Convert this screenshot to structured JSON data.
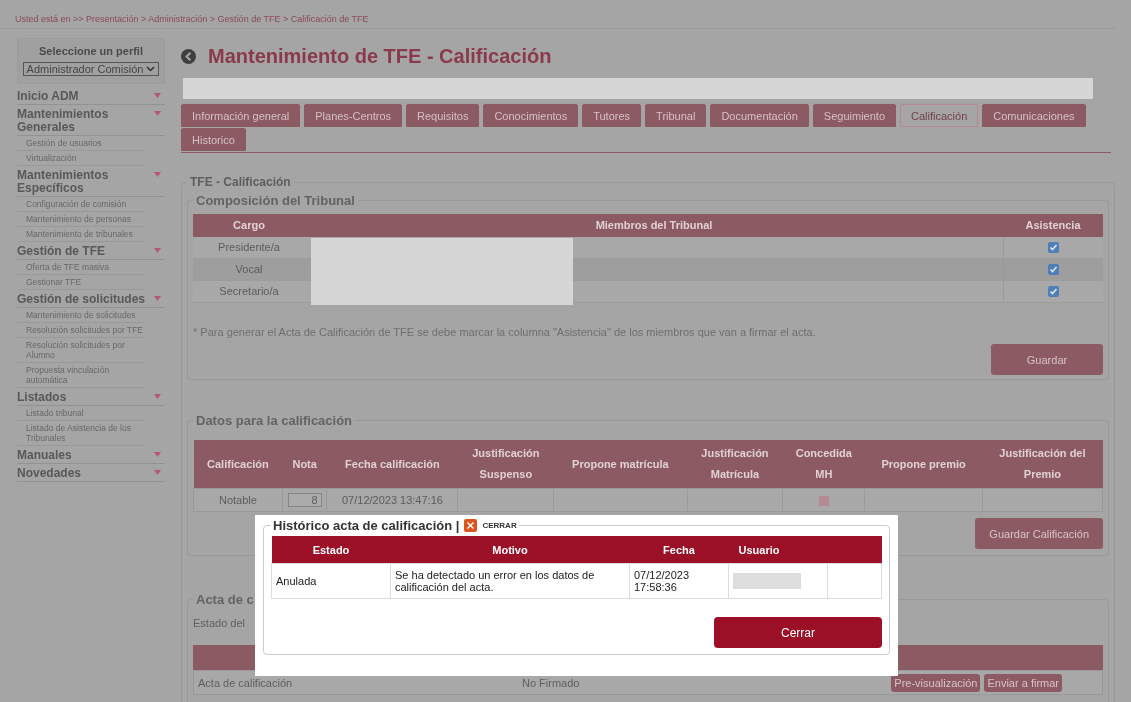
{
  "breadcrumb": "Usted está en >> Presentación > Administración > Gestión de TFE > Calificación de TFE",
  "sidebar": {
    "profile_label": "Seleccione un perfil",
    "profile_value": "Administrador Comisión",
    "sections": [
      {
        "label": "Inicio ADM"
      },
      {
        "label": "Mantenimientos Generales",
        "children": [
          {
            "label": "Gestión de usuarios"
          },
          {
            "label": "Virtualización"
          }
        ]
      },
      {
        "label": "Mantenimientos Específicos",
        "children": [
          {
            "label": "Configuración de comisión"
          },
          {
            "label": "Mantenimiento de personas"
          },
          {
            "label": "Mantenimiento de tribunales"
          }
        ]
      },
      {
        "label": "Gestión de TFE",
        "children": [
          {
            "label": "Oferta de TFE masiva"
          },
          {
            "label": "Gestionar TFE"
          }
        ]
      },
      {
        "label": "Gestión de solicitudes",
        "children": [
          {
            "label": "Mantenimiento de solicitudes"
          },
          {
            "label": "Resolución solicitudes por TFE"
          },
          {
            "label": "Resolución solicitudes por Alumno"
          },
          {
            "label": "Propuesta vinculación automática"
          }
        ]
      },
      {
        "label": "Listados",
        "children": [
          {
            "label": "Listado tribunal"
          },
          {
            "label": "Listado de Asistencia de los Tribunales"
          }
        ]
      },
      {
        "label": "Manuales"
      },
      {
        "label": "Novedades"
      }
    ]
  },
  "page_title": "Mantenimiento de TFE - Calificación",
  "tabs": [
    {
      "label": "Información general",
      "selected": false
    },
    {
      "label": "Planes-Centros",
      "selected": false
    },
    {
      "label": "Requisitos",
      "selected": false
    },
    {
      "label": "Conocimientos",
      "selected": false
    },
    {
      "label": "Tutores",
      "selected": false
    },
    {
      "label": "Tribunal",
      "selected": false
    },
    {
      "label": "Documentación",
      "selected": false
    },
    {
      "label": "Seguimiento",
      "selected": false
    },
    {
      "label": "Calificación",
      "selected": true
    },
    {
      "label": "Comunicaciones",
      "selected": false
    },
    {
      "label": "Historico",
      "selected": false
    }
  ],
  "main_legend": "TFE - Calificación",
  "tribunal": {
    "legend": "Composición del Tribunal",
    "columns": [
      "Cargo",
      "Miembros del Tribunal",
      "Asistencia"
    ],
    "rows": [
      {
        "cargo": "Presidente/a",
        "asistencia": true
      },
      {
        "cargo": "Vocal",
        "asistencia": true
      },
      {
        "cargo": "Secretario/a",
        "asistencia": true
      }
    ],
    "note": "* Para generar el Acta de Calificación de TFE se debe marcar la columna \"Asistencia\" de los miembros que van a firmar el acta.",
    "save_button": "Guardar"
  },
  "grading": {
    "legend": "Datos para la calificación",
    "columns": [
      "Calificación",
      "Nota",
      "Fecha calificación",
      "Justificación\nSuspenso",
      "Propone matrícula",
      "Justificación\nMatrícula",
      "Concedida\nMH",
      "Propone premio",
      "Justificación del\nPremio"
    ],
    "rows": [
      {
        "calificacion": "Notable",
        "nota": "8",
        "fecha": "07/12/2023 13:47:16",
        "concedida_mh": false
      }
    ],
    "save_button": "Guardar Calificación"
  },
  "acta": {
    "legend": "Acta de c",
    "estado_label": "Estado del",
    "rows": [
      {
        "documento": "Acta de calificación",
        "estado": "No Firmado",
        "buttons": [
          "Pre-visualización",
          "Enviar a firmar"
        ]
      }
    ]
  },
  "modal": {
    "title": "Histórico acta de calificación |",
    "close_link": "CERRAR",
    "columns": [
      "Estado",
      "Motivo",
      "Fecha",
      "Usuario"
    ],
    "rows": [
      {
        "estado": "Anulada",
        "motivo": "Se ha detectado un error en los datos de calificación del acta.",
        "fecha": "07/12/2023 17:58:36"
      }
    ],
    "close_button": "Cerrar"
  }
}
